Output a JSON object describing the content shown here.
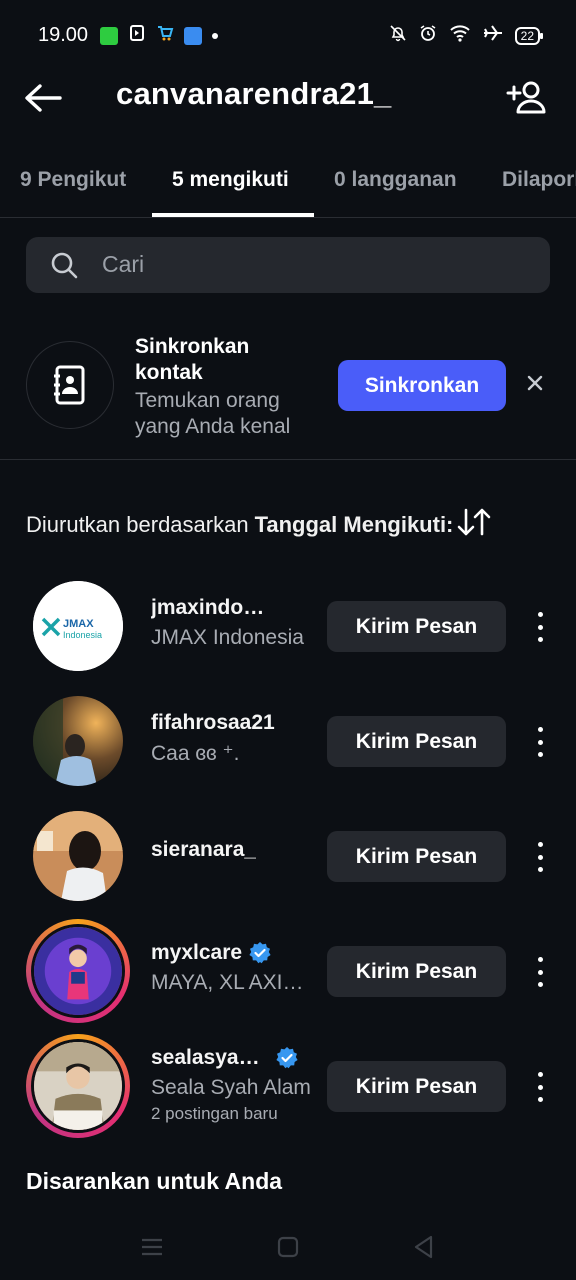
{
  "status_bar": {
    "time": "19.00",
    "battery": "22"
  },
  "header": {
    "title": "canvanarendra21_"
  },
  "tabs": [
    {
      "label": "9 Pengikut"
    },
    {
      "label": "5 mengikuti"
    },
    {
      "label": "0 langganan"
    },
    {
      "label": "Dilaporkan"
    }
  ],
  "search": {
    "placeholder": "Cari"
  },
  "sync": {
    "title": "Sinkronkan kontak",
    "subtitle": "Temukan orang yang Anda kenal",
    "button": "Sinkronkan"
  },
  "sort": {
    "prefix": "Diurutkan berdasarkan",
    "value": "Tanggal Mengikuti:"
  },
  "following": [
    {
      "username": "jmaxindonesia",
      "display_name": "JMAX Indonesia",
      "sub": "",
      "verified": false,
      "button": "Kirim Pesan"
    },
    {
      "username": "fifahrosaa21",
      "display_name": "Caa ɞɞ ⁺.",
      "sub": "",
      "verified": false,
      "button": "Kirim Pesan"
    },
    {
      "username": "sieranara_",
      "display_name": "",
      "sub": "",
      "verified": false,
      "button": "Kirim Pesan"
    },
    {
      "username": "myxlcare",
      "display_name": "MAYA, XL AXIATA",
      "sub": "",
      "verified": true,
      "button": "Kirim Pesan"
    },
    {
      "username": "sealasyahalam",
      "display_name": "Seala Syah Alam",
      "sub": "2 postingan baru",
      "verified": true,
      "button": "Kirim Pesan"
    }
  ],
  "jmax_logo": {
    "line1": "JMAX",
    "line2": "Indonesia"
  },
  "suggested": {
    "heading": "Disarankan untuk Anda"
  },
  "colors": {
    "background": "#0c0f14",
    "accent": "#4a5df9",
    "verified": "#3797f0"
  }
}
